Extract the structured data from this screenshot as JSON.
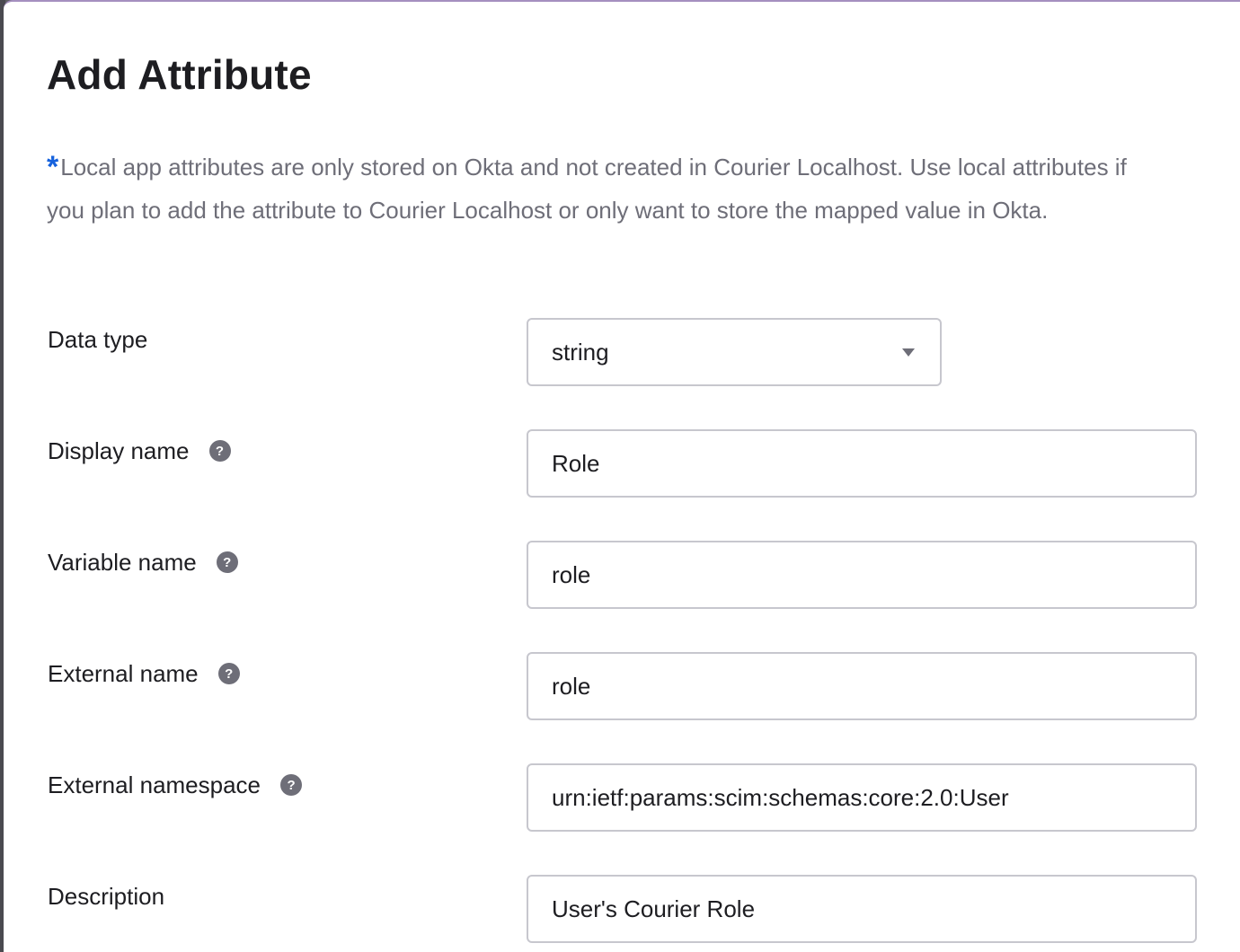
{
  "dialog": {
    "title": "Add Attribute",
    "note_marker": "*",
    "note": "Local app attributes are only stored on Okta and not created in Courier Localhost. Use local attributes if you plan to add the attribute to Courier Localhost or only want to store the mapped value in Okta."
  },
  "help_icon_glyph": "?",
  "fields": {
    "data_type": {
      "label": "Data type",
      "value": "string"
    },
    "display_name": {
      "label": "Display name",
      "value": "Role"
    },
    "variable_name": {
      "label": "Variable name",
      "value": "role"
    },
    "external_name": {
      "label": "External name",
      "value": "role"
    },
    "external_namespace": {
      "label": "External namespace",
      "value": "urn:ietf:params:scim:schemas:core:2.0:User"
    },
    "description": {
      "label": "Description",
      "value": "User's Courier Role"
    }
  },
  "colors": {
    "accent": "#1662dd",
    "text": "#1d1d21",
    "muted_text": "#6e6e78",
    "border": "#c7c7ce"
  }
}
